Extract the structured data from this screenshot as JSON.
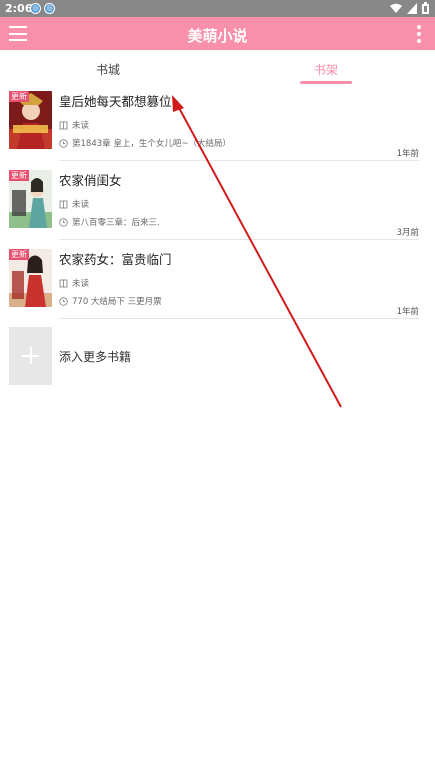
{
  "status_bar": {
    "time": "2:06",
    "notification_icons": [
      "notification-app-icon",
      "notification-app-icon"
    ],
    "system_icons": [
      "wifi-icon",
      "cell-signal-icon",
      "battery-icon"
    ]
  },
  "app_bar": {
    "title": "美萌小说",
    "menu_icon": "hamburger-menu-icon",
    "more_icon": "overflow-menu-icon",
    "color": "#f88fab"
  },
  "tabs": [
    {
      "label": "书城",
      "active": false
    },
    {
      "label": "书架",
      "active": true
    }
  ],
  "books": [
    {
      "title": "皇后她每天都想篡位",
      "badge": "更新",
      "status": "未读",
      "latest_chapter": "第1843章 皇上，生个女儿吧~（大结局）",
      "updated": "1年前",
      "status_icon": "book-icon",
      "chapter_icon": "clock-icon"
    },
    {
      "title": "农家俏闺女",
      "badge": "更新",
      "status": "未读",
      "latest_chapter": "第八百零三章：后来三.",
      "updated": "3月前",
      "status_icon": "book-icon",
      "chapter_icon": "clock-icon"
    },
    {
      "title": "农家药女：富贵临门",
      "badge": "更新",
      "status": "未读",
      "latest_chapter": "770 大结局下 三更月票",
      "updated": "1年前",
      "status_icon": "book-icon",
      "chapter_icon": "clock-icon"
    }
  ],
  "add_more": {
    "label": "添入更多书籍",
    "icon": "plus-icon"
  },
  "colors": {
    "accent": "#f88fab",
    "annotation_arrow": "#d11a1a"
  }
}
